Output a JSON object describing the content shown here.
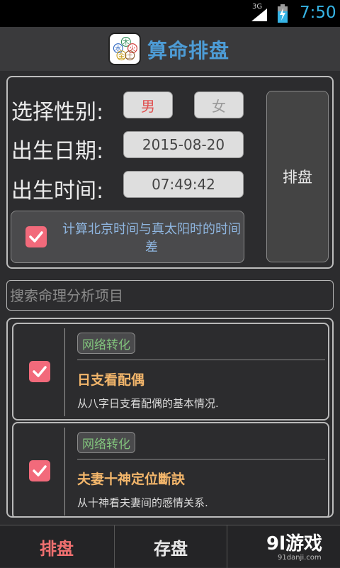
{
  "status_bar": {
    "network": "3G",
    "time": "7:50"
  },
  "app": {
    "title": "算命排盘",
    "logo_chars": [
      "木",
      "水",
      "火",
      "金",
      "土"
    ]
  },
  "form": {
    "gender_label": "选择性别:",
    "gender_options": [
      "男",
      "女"
    ],
    "gender_selected": "男",
    "birth_date_label": "出生日期:",
    "birth_date": "2015-08-20",
    "birth_time_label": "出生时间:",
    "birth_time": "07:49:42",
    "plate_button": "排盘",
    "tz_checkbox_label": "计算北京时间与真太阳时的时间差",
    "tz_checked": true
  },
  "search": {
    "placeholder": "搜索命理分析项目"
  },
  "items": [
    {
      "tag": "网络转化",
      "title": "日支看配偶",
      "desc": "从八字日支看配偶的基本情况.",
      "checked": true
    },
    {
      "tag": "网络转化",
      "title": "夫妻十神定位斷訣",
      "desc": "从十神看夫妻间的感情关系.",
      "checked": true
    }
  ],
  "bottom_tabs": [
    "排盘",
    "存盘"
  ],
  "watermark": {
    "big": "9l游戏",
    "small": "91danji.com"
  },
  "colors": {
    "accent_blue": "#4d9cd6",
    "checkbox_red": "#f26a7b",
    "tag_green": "#82c47d",
    "title_orange": "#f3b66b",
    "active_tab": "#f07070"
  }
}
